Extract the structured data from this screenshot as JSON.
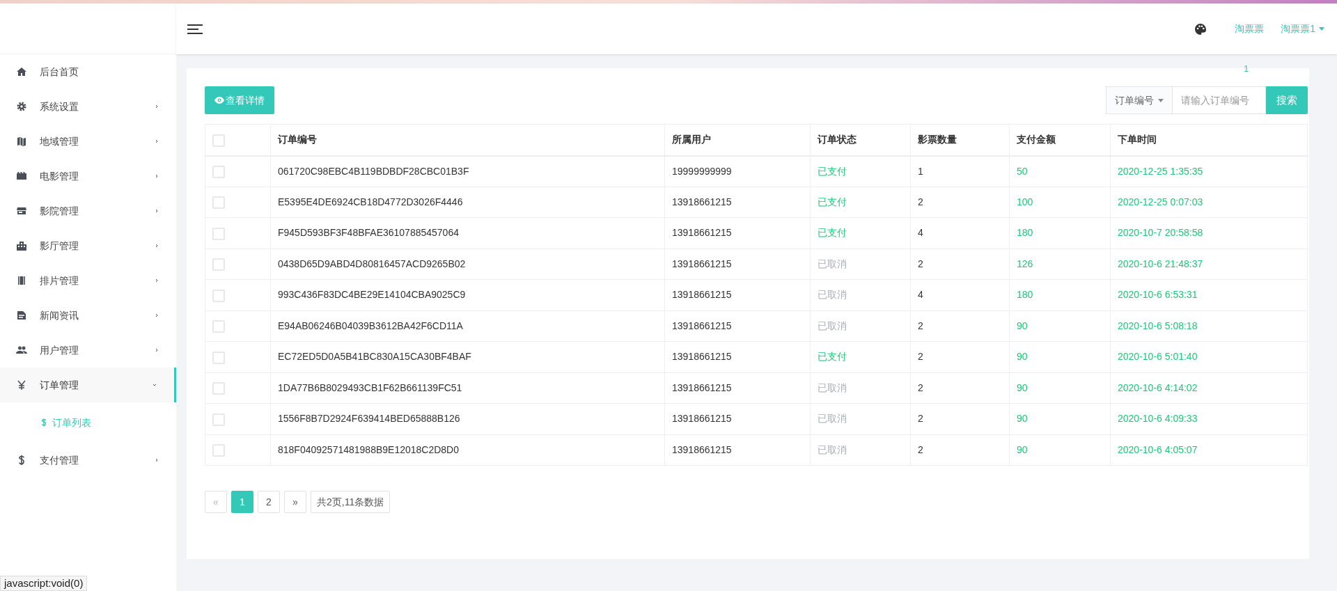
{
  "sidebar": {
    "items": [
      {
        "label": "后台首页",
        "selected": false
      },
      {
        "label": "系统设置",
        "selected": false,
        "expanded": false
      },
      {
        "label": "地域管理",
        "selected": false,
        "expanded": false
      },
      {
        "label": "电影管理",
        "selected": false,
        "expanded": false
      },
      {
        "label": "影院管理",
        "selected": false,
        "expanded": false
      },
      {
        "label": "影厅管理",
        "selected": false,
        "expanded": false
      },
      {
        "label": "排片管理",
        "selected": false,
        "expanded": false
      },
      {
        "label": "新闻资讯",
        "selected": false,
        "expanded": false
      },
      {
        "label": "用户管理",
        "selected": false,
        "expanded": false
      },
      {
        "label": "订单管理",
        "selected": true,
        "expanded": true,
        "children": [
          {
            "label": "订单列表",
            "selected": true
          }
        ]
      },
      {
        "label": "支付管理",
        "selected": false,
        "expanded": false
      }
    ]
  },
  "header": {
    "links": [
      "淘票票",
      "淘票票1"
    ],
    "badge": "1"
  },
  "toolbar": {
    "detail_button": "查看详情",
    "search_select": "订单编号",
    "search_placeholder": "请输入订单编号",
    "search_button": "搜索"
  },
  "table": {
    "header_checked": false,
    "columns": [
      "订单编号",
      "所属用户",
      "订单状态",
      "影票数量",
      "支付金额",
      "下单时间"
    ],
    "rows": [
      {
        "checked": false,
        "cancelled": false,
        "cells": [
          "061720C98EBC4B119BDBDF28CBC01B3F",
          "19999999999",
          "已支付",
          "1",
          "50",
          "2020-12-25 1:35:35"
        ]
      },
      {
        "checked": false,
        "cancelled": false,
        "cells": [
          "E5395E4DE6924CB18D4772D3026F4446",
          "13918661215",
          "已支付",
          "2",
          "100",
          "2020-12-25 0:07:03"
        ]
      },
      {
        "checked": false,
        "cancelled": false,
        "cells": [
          "F945D593BF3F48BFAE36107885457064",
          "13918661215",
          "已支付",
          "4",
          "180",
          "2020-10-7 20:58:58"
        ]
      },
      {
        "checked": false,
        "cancelled": true,
        "cells": [
          "0438D65D9ABD4D80816457ACD9265B02",
          "13918661215",
          "已取消",
          "2",
          "126",
          "2020-10-6 21:48:37"
        ]
      },
      {
        "checked": false,
        "cancelled": true,
        "cells": [
          "993C436F83DC4BE29E14104CBA9025C9",
          "13918661215",
          "已取消",
          "4",
          "180",
          "2020-10-6 6:53:31"
        ]
      },
      {
        "checked": false,
        "cancelled": true,
        "cells": [
          "E94AB06246B04039B3612BA42F6CD11A",
          "13918661215",
          "已取消",
          "2",
          "90",
          "2020-10-6 5:08:18"
        ]
      },
      {
        "checked": false,
        "cancelled": false,
        "cells": [
          "EC72ED5D0A5B41BC830A15CA30BF4BAF",
          "13918661215",
          "已支付",
          "2",
          "90",
          "2020-10-6 5:01:40"
        ]
      },
      {
        "checked": false,
        "cancelled": true,
        "cells": [
          "1DA77B6B8029493CB1F62B661139FC51",
          "13918661215",
          "已取消",
          "2",
          "90",
          "2020-10-6 4:14:02"
        ]
      },
      {
        "checked": false,
        "cancelled": true,
        "cells": [
          "1556F8B7D2924F639414BED65888B126",
          "13918661215",
          "已取消",
          "2",
          "90",
          "2020-10-6 4:09:33"
        ]
      },
      {
        "checked": false,
        "cancelled": true,
        "cells": [
          "818F04092571481988B9E12018C2D8D0",
          "13918661215",
          "已取消",
          "2",
          "90",
          "2020-10-6 4:05:07"
        ]
      }
    ]
  },
  "pagination": {
    "prev": "«",
    "pages": [
      {
        "label": "1",
        "selected": true
      },
      {
        "label": "2",
        "selected": false
      }
    ],
    "next": "»",
    "summary": "共2页,11条数据"
  },
  "status_bar": "javascript:void(0)"
}
